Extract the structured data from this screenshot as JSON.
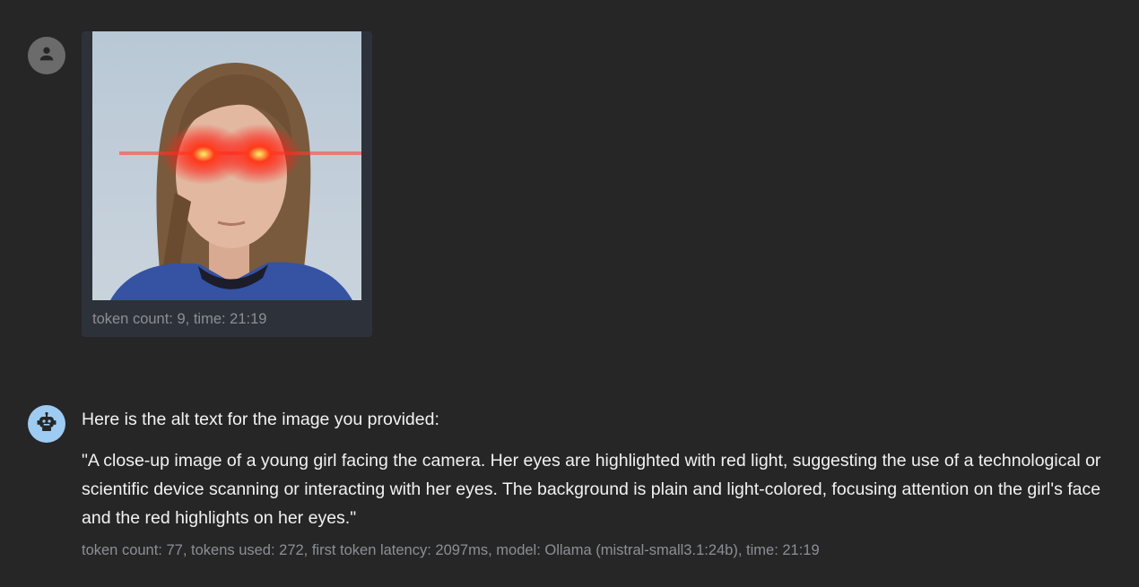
{
  "user_message": {
    "avatar_icon": "person-icon",
    "image_icon": "photo-attachment",
    "meta": "token count: 9, time: 21:19"
  },
  "assistant_message": {
    "avatar_icon": "robot-icon",
    "intro": "Here is the alt text for the image you provided:",
    "body": "\"A close-up image of a young girl facing the camera. Her eyes are highlighted with red light, suggesting the use of a technological or scientific device scanning or interacting with her eyes. The background is plain and light-colored, focusing attention on the girl's face and the red highlights on her eyes.\"",
    "meta": "token count: 77, tokens used: 272, first token latency: 2097ms, model: Ollama (mistral-small3.1:24b), time: 21:19"
  },
  "colors": {
    "background": "#262626",
    "user_bubble": "#2d323a",
    "user_avatar": "#6b6b6b",
    "bot_avatar": "#9ecbf2",
    "text": "#f2f2f2",
    "meta_text": "#8c8f94"
  }
}
